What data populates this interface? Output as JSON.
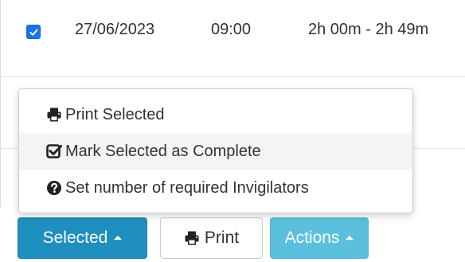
{
  "table": {
    "row": {
      "checked": true,
      "date": "27/06/2023",
      "time": "09:00",
      "duration": "2h 00m - 2h 49m"
    }
  },
  "menu": {
    "items": [
      {
        "label": "Print Selected",
        "icon": "print-icon"
      },
      {
        "label": "Mark Selected as Complete",
        "icon": "check-square-icon"
      },
      {
        "label": "Set number of required Invigilators",
        "icon": "question-circle-icon"
      }
    ]
  },
  "toolbar": {
    "selected_label": "Selected",
    "print_label": "Print",
    "actions_label": "Actions"
  },
  "colors": {
    "primary": "#1f8fbf",
    "info": "#5bc0de",
    "checkbox": "#1a73e8"
  }
}
